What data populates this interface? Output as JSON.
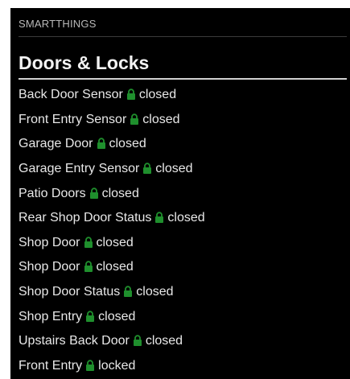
{
  "module": {
    "header": "SMARTTHINGS",
    "section_title": "Doors & Locks"
  },
  "colors": {
    "lock_icon": "#1f8f2d",
    "panel_bg": "#000000",
    "text": "#e8e8e8"
  },
  "devices": [
    {
      "name": "Back Door Sensor",
      "icon": "lock-icon",
      "status": "closed"
    },
    {
      "name": "Front Entry Sensor",
      "icon": "lock-icon",
      "status": "closed"
    },
    {
      "name": "Garage Door",
      "icon": "lock-icon",
      "status": "closed"
    },
    {
      "name": "Garage Entry Sensor",
      "icon": "lock-icon",
      "status": "closed"
    },
    {
      "name": "Patio Doors",
      "icon": "lock-icon",
      "status": "closed"
    },
    {
      "name": "Rear Shop Door Status",
      "icon": "lock-icon",
      "status": "closed"
    },
    {
      "name": "Shop Door",
      "icon": "lock-icon",
      "status": "closed"
    },
    {
      "name": "Shop Door",
      "icon": "lock-icon",
      "status": "closed"
    },
    {
      "name": "Shop Door Status",
      "icon": "lock-icon",
      "status": "closed"
    },
    {
      "name": "Shop Entry",
      "icon": "lock-icon",
      "status": "closed"
    },
    {
      "name": "Upstairs Back Door",
      "icon": "lock-icon",
      "status": "closed"
    },
    {
      "name": "Front Entry",
      "icon": "lock-icon",
      "status": "locked"
    }
  ]
}
